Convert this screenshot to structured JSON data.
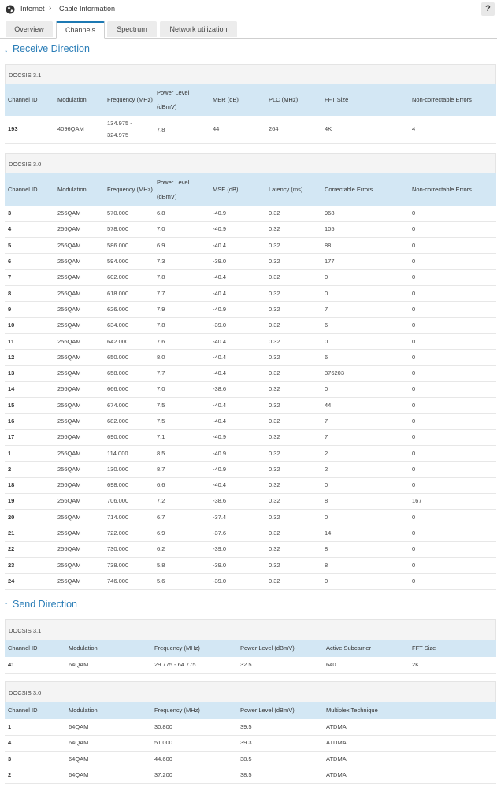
{
  "breadcrumb": {
    "root": "Internet",
    "current": "Cable Information"
  },
  "help_label": "?",
  "tabs": [
    {
      "label": "Overview",
      "active": false
    },
    {
      "label": "Channels",
      "active": true
    },
    {
      "label": "Spectrum",
      "active": false
    },
    {
      "label": "Network utilization",
      "active": false
    }
  ],
  "receive": {
    "title": "Receive Direction",
    "d31": {
      "label": "DOCSIS 3.1",
      "headers": [
        "Channel ID",
        "Modulation",
        "Frequency (MHz)",
        "Power Level (dBmV)",
        "MER (dB)",
        "PLC (MHz)",
        "FFT Size",
        "Non-correctable Errors"
      ],
      "rows": [
        [
          "193",
          "4096QAM",
          "134.975 - 324.975",
          "7.8",
          "44",
          "264",
          "4K",
          "4"
        ]
      ]
    },
    "d30": {
      "label": "DOCSIS 3.0",
      "headers": [
        "Channel ID",
        "Modulation",
        "Frequency (MHz)",
        "Power Level (dBmV)",
        "MSE (dB)",
        "Latency (ms)",
        "Correctable Errors",
        "Non-correctable Errors"
      ],
      "rows": [
        [
          "3",
          "256QAM",
          "570.000",
          "6.8",
          "-40.9",
          "0.32",
          "968",
          "0"
        ],
        [
          "4",
          "256QAM",
          "578.000",
          "7.0",
          "-40.9",
          "0.32",
          "105",
          "0"
        ],
        [
          "5",
          "256QAM",
          "586.000",
          "6.9",
          "-40.4",
          "0.32",
          "88",
          "0"
        ],
        [
          "6",
          "256QAM",
          "594.000",
          "7.3",
          "-39.0",
          "0.32",
          "177",
          "0"
        ],
        [
          "7",
          "256QAM",
          "602.000",
          "7.8",
          "-40.4",
          "0.32",
          "0",
          "0"
        ],
        [
          "8",
          "256QAM",
          "618.000",
          "7.7",
          "-40.4",
          "0.32",
          "0",
          "0"
        ],
        [
          "9",
          "256QAM",
          "626.000",
          "7.9",
          "-40.9",
          "0.32",
          "7",
          "0"
        ],
        [
          "10",
          "256QAM",
          "634.000",
          "7.8",
          "-39.0",
          "0.32",
          "6",
          "0"
        ],
        [
          "11",
          "256QAM",
          "642.000",
          "7.6",
          "-40.4",
          "0.32",
          "0",
          "0"
        ],
        [
          "12",
          "256QAM",
          "650.000",
          "8.0",
          "-40.4",
          "0.32",
          "6",
          "0"
        ],
        [
          "13",
          "256QAM",
          "658.000",
          "7.7",
          "-40.4",
          "0.32",
          "376203",
          "0"
        ],
        [
          "14",
          "256QAM",
          "666.000",
          "7.0",
          "-38.6",
          "0.32",
          "0",
          "0"
        ],
        [
          "15",
          "256QAM",
          "674.000",
          "7.5",
          "-40.4",
          "0.32",
          "44",
          "0"
        ],
        [
          "16",
          "256QAM",
          "682.000",
          "7.5",
          "-40.4",
          "0.32",
          "7",
          "0"
        ],
        [
          "17",
          "256QAM",
          "690.000",
          "7.1",
          "-40.9",
          "0.32",
          "7",
          "0"
        ],
        [
          "1",
          "256QAM",
          "114.000",
          "8.5",
          "-40.9",
          "0.32",
          "2",
          "0"
        ],
        [
          "2",
          "256QAM",
          "130.000",
          "8.7",
          "-40.9",
          "0.32",
          "2",
          "0"
        ],
        [
          "18",
          "256QAM",
          "698.000",
          "6.6",
          "-40.4",
          "0.32",
          "0",
          "0"
        ],
        [
          "19",
          "256QAM",
          "706.000",
          "7.2",
          "-38.6",
          "0.32",
          "8",
          "167"
        ],
        [
          "20",
          "256QAM",
          "714.000",
          "6.7",
          "-37.4",
          "0.32",
          "0",
          "0"
        ],
        [
          "21",
          "256QAM",
          "722.000",
          "6.9",
          "-37.6",
          "0.32",
          "14",
          "0"
        ],
        [
          "22",
          "256QAM",
          "730.000",
          "6.2",
          "-39.0",
          "0.32",
          "8",
          "0"
        ],
        [
          "23",
          "256QAM",
          "738.000",
          "5.8",
          "-39.0",
          "0.32",
          "8",
          "0"
        ],
        [
          "24",
          "256QAM",
          "746.000",
          "5.6",
          "-39.0",
          "0.32",
          "0",
          "0"
        ]
      ]
    }
  },
  "send": {
    "title": "Send Direction",
    "d31": {
      "label": "DOCSIS 3.1",
      "headers": [
        "Channel ID",
        "Modulation",
        "Frequency (MHz)",
        "Power Level (dBmV)",
        "Active Subcarrier",
        "FFT Size"
      ],
      "rows": [
        [
          "41",
          "64QAM",
          "29.775 - 64.775",
          "32.5",
          "640",
          "2K"
        ]
      ]
    },
    "d30": {
      "label": "DOCSIS 3.0",
      "headers": [
        "Channel ID",
        "Modulation",
        "Frequency (MHz)",
        "Power Level (dBmV)",
        "Multiplex Technique"
      ],
      "rows": [
        [
          "1",
          "64QAM",
          "30.800",
          "39.5",
          "ATDMA"
        ],
        [
          "4",
          "64QAM",
          "51.000",
          "39.3",
          "ATDMA"
        ],
        [
          "3",
          "64QAM",
          "44.600",
          "38.5",
          "ATDMA"
        ],
        [
          "2",
          "64QAM",
          "37.200",
          "38.5",
          "ATDMA"
        ]
      ]
    }
  },
  "colors": {
    "accent": "#2a7db7",
    "header_bg": "#d3e7f4",
    "tab_bg": "#ececec"
  }
}
